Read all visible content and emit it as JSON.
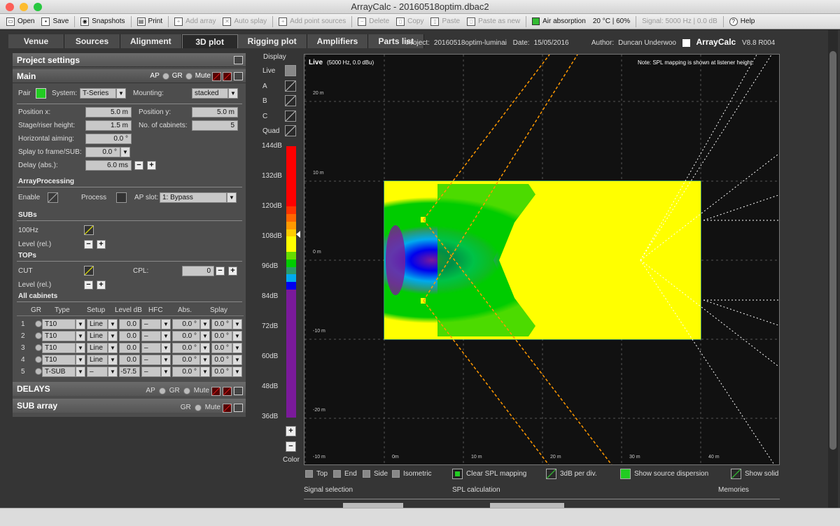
{
  "window": {
    "title": "ArrayCalc - 20160518optim.dbac2"
  },
  "toolbar": {
    "items": [
      {
        "label": "Open",
        "icon": "open-icon",
        "enabled": true
      },
      {
        "label": "Save",
        "icon": "save-icon",
        "enabled": true
      },
      {
        "label": "Snapshots",
        "icon": "snapshots-icon",
        "enabled": true
      },
      {
        "label": "Print",
        "icon": "print-icon",
        "enabled": true
      },
      {
        "label": "Add array",
        "icon": "add-array-icon",
        "enabled": false
      },
      {
        "label": "Auto splay",
        "icon": "auto-splay-icon",
        "enabled": false
      },
      {
        "label": "Add point sources",
        "icon": "add-point-sources-icon",
        "enabled": false
      },
      {
        "label": "Delete",
        "icon": "delete-icon",
        "enabled": false
      },
      {
        "label": "Copy",
        "icon": "copy-icon",
        "enabled": false
      },
      {
        "label": "Paste",
        "icon": "paste-icon",
        "enabled": false
      },
      {
        "label": "Paste as new",
        "icon": "paste-new-icon",
        "enabled": false
      }
    ],
    "air_absorption": "Air absorption",
    "air_conditions": "20 °C | 60%",
    "signal": "Signal: 5000 Hz | 0.0 dB",
    "help": "Help"
  },
  "tabs": [
    "Venue",
    "Sources",
    "Alignment",
    "3D plot",
    "Rigging plot",
    "Amplifiers",
    "Parts list"
  ],
  "active_tab": "3D plot",
  "project": {
    "project_label": "Project:",
    "project": "20160518optim-luminai",
    "date_label": "Date:",
    "date": "15/05/2016",
    "author_label": "Author:",
    "author": "Duncan Underwoo",
    "brand": "ArrayCalc",
    "version": "V8.8 R004"
  },
  "panel": {
    "settings_title": "Project settings",
    "main_title": "Main",
    "ap": "AP",
    "gr": "GR",
    "mute": "Mute",
    "pair": "Pair",
    "system_label": "System:",
    "system": "T-Series",
    "mounting_label": "Mounting:",
    "mounting": "stacked",
    "position_x_label": "Position x:",
    "position_x": "5.0 m",
    "position_y_label": "Position y:",
    "position_y": "5.0 m",
    "stage_label": "Stage/riser height:",
    "stage": "1.5 m",
    "cabinets_label": "No. of cabinets:",
    "cabinets": "5",
    "haim_label": "Horizontal aiming:",
    "haim": "0.0 °",
    "splay_label": "Splay to frame/SUB:",
    "splay": "0.0 °",
    "delay_label": "Delay (abs.):",
    "delay": "6.0 ms",
    "arrayproc": "ArrayProcessing",
    "enable": "Enable",
    "process": "Process",
    "apslot_label": "AP slot:",
    "apslot": "1: Bypass",
    "subs": "SUBs",
    "hz100": "100Hz",
    "level_rel": "Level (rel.)",
    "tops": "TOPs",
    "cut": "CUT",
    "cpl_label": "CPL:",
    "cpl": "0",
    "all_cab": "All cabinets",
    "columns": [
      "GR",
      "Type",
      "Setup",
      "Level dB",
      "HFC",
      "Abs.",
      "Splay"
    ],
    "rows": [
      {
        "n": "1",
        "type": "T10",
        "setup": "Line",
        "level": "0.0",
        "hfc": "–",
        "abs": "0.0 °",
        "splay": "0.0 °"
      },
      {
        "n": "2",
        "type": "T10",
        "setup": "Line",
        "level": "0.0",
        "hfc": "–",
        "abs": "0.0 °",
        "splay": "0.0 °"
      },
      {
        "n": "3",
        "type": "T10",
        "setup": "Line",
        "level": "0.0",
        "hfc": "–",
        "abs": "0.0 °",
        "splay": "0.0 °"
      },
      {
        "n": "4",
        "type": "T10",
        "setup": "Line",
        "level": "0.0",
        "hfc": "–",
        "abs": "0.0 °",
        "splay": "0.0 °"
      },
      {
        "n": "5",
        "type": "T-SUB",
        "setup": "–",
        "level": "-57.5",
        "hfc": "–",
        "abs": "0.0 °",
        "splay": "0.0 °"
      }
    ],
    "delays_title": "DELAYS",
    "subarray_title": "SUB array"
  },
  "display": {
    "title": "Display",
    "options": [
      "Live",
      "A",
      "B",
      "C",
      "Quad"
    ],
    "db_labels": [
      "144dB",
      "132dB",
      "120dB",
      "108dB",
      "96dB",
      "84dB",
      "72dB",
      "60dB",
      "48dB",
      "36dB"
    ],
    "scale_colors": [
      "#ff0000",
      "#ff0000",
      "#ff0000",
      "#ff0000",
      "#ff0000",
      "#ff0000",
      "#ff0000",
      "#ff0000",
      "#ff3300",
      "#ff6600",
      "#ff9900",
      "#ffcc00",
      "#ffff00",
      "#ffff00",
      "#66dd00",
      "#00cc00",
      "#2a9a6a",
      "#00aaee",
      "#0000ee",
      "#7a1a9a",
      "#7a1a9a",
      "#7a1a9a",
      "#7a1a9a",
      "#7a1a9a",
      "#7a1a9a",
      "#7a1a9a",
      "#7a1a9a",
      "#7a1a9a",
      "#7a1a9a",
      "#7a1a9a",
      "#7a1a9a",
      "#7a1a9a",
      "#7a1a9a",
      "#7a1a9a",
      "#7a1a9a",
      "#7a1a9a"
    ],
    "plus": "+",
    "minus": "−",
    "color": "Color"
  },
  "plot": {
    "live": "Live",
    "live_info": "(5000 Hz, 0.0 dBu)",
    "note": "Note: SPL mapping is shown at listener height.",
    "y_labels": [
      "20 m",
      "10 m",
      "0 m",
      "-10 m",
      "-20 m"
    ],
    "x_labels": [
      "-10 m",
      "0m",
      "10 m",
      "20 m",
      "30 m",
      "40 m"
    ]
  },
  "bottom": {
    "views": [
      "Top",
      "End",
      "Side",
      "Isometric"
    ],
    "clear_spl": "Clear SPL mapping",
    "db_div": "3dB per div.",
    "show_src": "Show source dispersion",
    "show_solid": "Show solid",
    "signal_sel": "Signal selection",
    "spl_calc": "SPL calculation",
    "memories": "Memories"
  }
}
